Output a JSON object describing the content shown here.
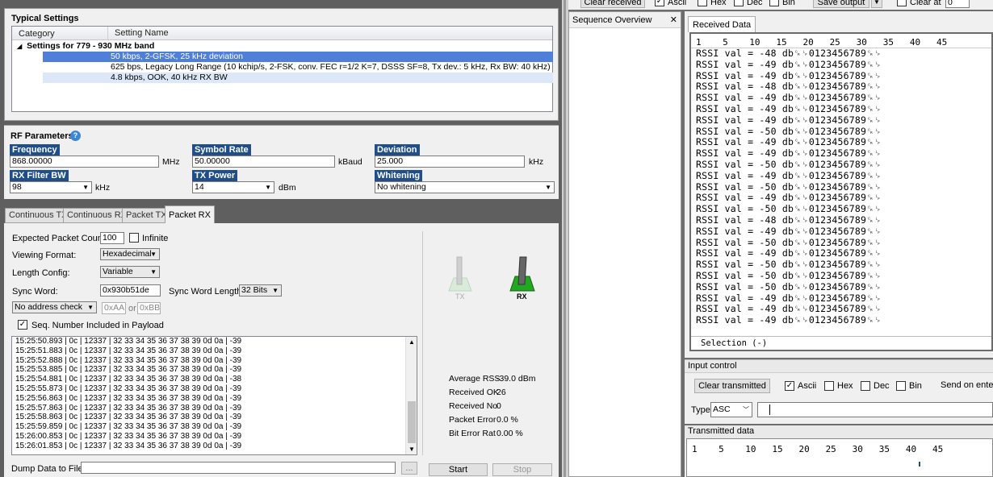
{
  "typical": {
    "title": "Typical Settings",
    "col_category": "Category",
    "col_setting": "Setting Name",
    "group": "Settings for 779 - 930 MHz band",
    "rows": [
      "50 kbps, 2-GFSK, 25 kHz deviation",
      "625 bps, Legacy Long Range (10 kchip/s, 2-FSK, conv. FEC r=1/2 K=7, DSSS SF=8, Tx dev.: 5 kHz, Rx BW: 40 kHz)",
      "4.8 kbps, OOK, 40 kHz RX BW"
    ]
  },
  "rf": {
    "title": "RF Parameters",
    "frequency_label": "Frequency",
    "frequency": "868.00000",
    "frequency_unit": "MHz",
    "symbol_rate_label": "Symbol Rate",
    "symbol_rate": "50.00000",
    "symbol_rate_unit": "kBaud",
    "deviation_label": "Deviation",
    "deviation": "25.000",
    "deviation_unit": "kHz",
    "rxbw_label": "RX Filter BW",
    "rxbw": "98",
    "rxbw_unit": "kHz",
    "txpower_label": "TX Power",
    "txpower": "14",
    "txpower_unit": "dBm",
    "whitening_label": "Whitening",
    "whitening": "No whitening"
  },
  "tabs": [
    "Continuous TX",
    "Continuous RX",
    "Packet TX",
    "Packet RX"
  ],
  "packet_rx": {
    "expected_count_label": "Expected Packet Count:",
    "expected_count": "100",
    "infinite_label": "Infinite",
    "viewing_format_label": "Viewing Format:",
    "viewing_format": "Hexadecimal",
    "length_config_label": "Length Config:",
    "length_config": "Variable",
    "sync_word_label": "Sync Word:",
    "sync_word": "0x930b51de",
    "sync_len_label": "Sync Word Length:",
    "sync_len": "32 Bits",
    "address_check": "No address check",
    "addr1": "0xAA",
    "or_label": "or",
    "addr2": "0xBB",
    "seq_label": "Seq. Number Included in Payload",
    "log": [
      "15:25:50.893 | 0c | 12337 | 32 33 34 35 36 37 38 39 0d 0a  |  -39",
      "15:25:51.883 | 0c | 12337 | 32 33 34 35 36 37 38 39 0d 0a  |  -39",
      "15:25:52.888 | 0c | 12337 | 32 33 34 35 36 37 38 39 0d 0a  |  -39",
      "15:25:53.885 | 0c | 12337 | 32 33 34 35 36 37 38 39 0d 0a  |  -39",
      "15:25:54.881 | 0c | 12337 | 32 33 34 35 36 37 38 39 0d 0a  |  -38",
      "15:25:55.873 | 0c | 12337 | 32 33 34 35 36 37 38 39 0d 0a  |  -39",
      "15:25:56.863 | 0c | 12337 | 32 33 34 35 36 37 38 39 0d 0a  |  -39",
      "15:25:57.863 | 0c | 12337 | 32 33 34 35 36 37 38 39 0d 0a  |  -39",
      "15:25:58.863 | 0c | 12337 | 32 33 34 35 36 37 38 39 0d 0a  |  -39",
      "15:25:59.859 | 0c | 12337 | 32 33 34 35 36 37 38 39 0d 0a  |  -39",
      "15:26:00.853 | 0c | 12337 | 32 33 34 35 36 37 38 39 0d 0a  |  -39",
      "15:26:01.853 | 0c | 12337 | 32 33 34 35 36 37 38 39 0d 0a  |  -39"
    ],
    "dump_label": "Dump Data to File:",
    "browse": "...",
    "start": "Start",
    "stop": "Stop",
    "tx_label": "TX",
    "rx_label": "RX",
    "stats": [
      {
        "label": "Average RSS",
        "value": "-39.0 dBm"
      },
      {
        "label": "Received OK",
        "value": "26"
      },
      {
        "label": "Received No",
        "value": "0"
      },
      {
        "label": "Packet Error",
        "value": "0.0 %"
      },
      {
        "label": "Bit Error Rat",
        "value": "0.00 %"
      }
    ]
  },
  "topbar": {
    "clear_received": "Clear received",
    "ascii": "Ascii",
    "hex": "Hex",
    "dec": "Dec",
    "bin": "Bin",
    "save_output": "Save output",
    "clear_at": "Clear at",
    "clear_at_val": "0"
  },
  "sequence": {
    "title": "Sequence Overview",
    "close": "✕"
  },
  "received": {
    "tab": "Received Data",
    "ruler": "1    5    10   15   20   25   30   35   40   45",
    "lines": [
      "RSSI val = -48 db␍␊0123456789␍␊",
      "RSSI val = -49 db␍␊0123456789␍␊",
      "RSSI val = -49 db␍␊0123456789␍␊",
      "RSSI val = -48 db␍␊0123456789␍␊",
      "RSSI val = -49 db␍␊0123456789␍␊",
      "RSSI val = -49 db␍␊0123456789␍␊",
      "RSSI val = -49 db␍␊0123456789␍␊",
      "RSSI val = -50 db␍␊0123456789␍␊",
      "RSSI val = -49 db␍␊0123456789␍␊",
      "RSSI val = -49 db␍␊0123456789␍␊",
      "RSSI val = -50 db␍␊0123456789␍␊",
      "RSSI val = -49 db␍␊0123456789␍␊",
      "RSSI val = -50 db␍␊0123456789␍␊",
      "RSSI val = -49 db␍␊0123456789␍␊",
      "RSSI val = -50 db␍␊0123456789␍␊",
      "RSSI val = -48 db␍␊0123456789␍␊",
      "RSSI val = -49 db␍␊0123456789␍␊",
      "RSSI val = -50 db␍␊0123456789␍␊",
      "RSSI val = -49 db␍␊0123456789␍␊",
      "RSSI val = -50 db␍␊0123456789␍␊",
      "RSSI val = -50 db␍␊0123456789␍␊",
      "RSSI val = -50 db␍␊0123456789␍␊",
      "RSSI val = -49 db␍␊0123456789␍␊",
      "RSSI val = -49 db␍␊0123456789␍␊",
      "RSSI val = -49 db␍␊0123456789␍␊"
    ],
    "selection": "Selection (-)"
  },
  "input_control": {
    "title": "Input control",
    "clear_transmitted": "Clear transmitted",
    "ascii": "Ascii",
    "hex": "Hex",
    "dec": "Dec",
    "bin": "Bin",
    "send_on_enter": "Send on ente",
    "type_label": "Type",
    "type_value": "ASC"
  },
  "transmitted": {
    "title": "Transmitted data",
    "ruler": "1    5    10   15   20   25   30   35   40   45"
  },
  "colors": {
    "selected_row": "#4f7fd9",
    "alt_row": "#dce8f8",
    "label_blue": "#1f4e8c",
    "switch_green": "#22a722"
  }
}
